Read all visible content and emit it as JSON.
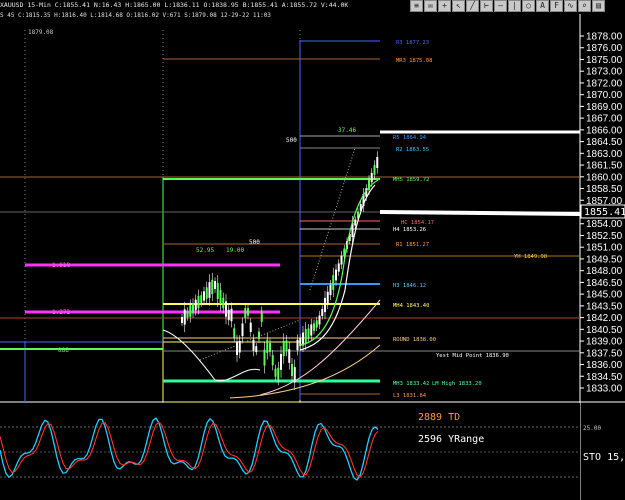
{
  "window": {
    "title": "XAUUSD 15-Min  C:1855.41 N:16.43 H:1865.00 L:1836.11 O:1838.95 B:1855.41 A:1855.72 V:44.0K",
    "subinfo": "S 45  C:1815.35 H:1816.40 L:1814.68 O:1816.02 V:671  S:1879.08 12-29-22 11:03"
  },
  "toolbar_icons": [
    "lines-icon",
    "envelope-icon",
    "crosshair-icon",
    "cursor-icon",
    "draw-icon",
    "ruler-icon",
    "hline-icon",
    "vline-icon",
    "circle-icon",
    "text-icon",
    "fib-icon",
    "wave-icon",
    "zoom-icon",
    "print-icon"
  ],
  "colors": {
    "background": "#000000",
    "price_line": "#ffffff",
    "pivot_green": "#00ff55",
    "fib_magenta": "#ff33ff",
    "mid_yellow": "#ffff66",
    "stoch_red": "#ff3322",
    "stoch_cyan": "#22ccff",
    "td_orange": "#ff9933"
  },
  "price_axis": {
    "ticks": [
      "1878.00",
      "1876.00",
      "1875.00",
      "1873.00",
      "1872.00",
      "1870.00",
      "1869.00",
      "1867.00",
      "1866.00",
      "1864.50",
      "1863.00",
      "1861.50",
      "1860.00",
      "1858.50",
      "1857.00",
      "1855.41",
      "1854.00",
      "1852.50",
      "1851.00",
      "1849.50",
      "1848.00",
      "1846.50",
      "1845.00",
      "1843.50",
      "1842.00",
      "1840.50",
      "1839.00",
      "1837.50",
      "1836.00",
      "1834.50",
      "1833.00"
    ],
    "current": "1855.41"
  },
  "levels": [
    {
      "label": "R3  1877.23",
      "color": "#4466ff"
    },
    {
      "label": "MR3  1875.08",
      "color": "#ff9944"
    },
    {
      "label": "R5  1864.94",
      "color": "#3399ff"
    },
    {
      "label": "R2  1863.55",
      "color": "#33ccff"
    },
    {
      "label": "MH5  1859.72",
      "color": "#55ff55"
    },
    {
      "label": "HC  1854.17",
      "color": "#ff6666"
    },
    {
      "label": "H4  1853.26",
      "color": "#ffffff"
    },
    {
      "label": "R1  1851.27",
      "color": "#ff9944"
    },
    {
      "label": "YH  1849.98",
      "color": "#ffcc33"
    },
    {
      "label": "H3  1846.12",
      "color": "#55ccff"
    },
    {
      "label": "MH4  1843.40",
      "color": "#ffff55"
    },
    {
      "label": "ROUND  1838.00",
      "color": "#ffcc88"
    },
    {
      "label": "Yest Mid Point  1836.90",
      "color": "#ffffff"
    },
    {
      "label": "MH3  1833.42",
      "color": "#55ff99"
    },
    {
      "label": "LM High  1833.20",
      "color": "#55ff99"
    },
    {
      "label": "L3  1831.84",
      "color": "#ff9944"
    }
  ],
  "annotations": {
    "top_left_price": "1879.08",
    "fib_1": "1.618",
    "fib_2": "1.272",
    "label_500_a": "500",
    "label_500_b": "500",
    "label_37": "37.46",
    "label_52": "52.95",
    "label_19": "19.00",
    "label_888": "888"
  },
  "indicator": {
    "td": "2889 TD",
    "yrange": "2596 YRange",
    "sto_label": "STO  15,",
    "tick_25": "25.00"
  }
}
